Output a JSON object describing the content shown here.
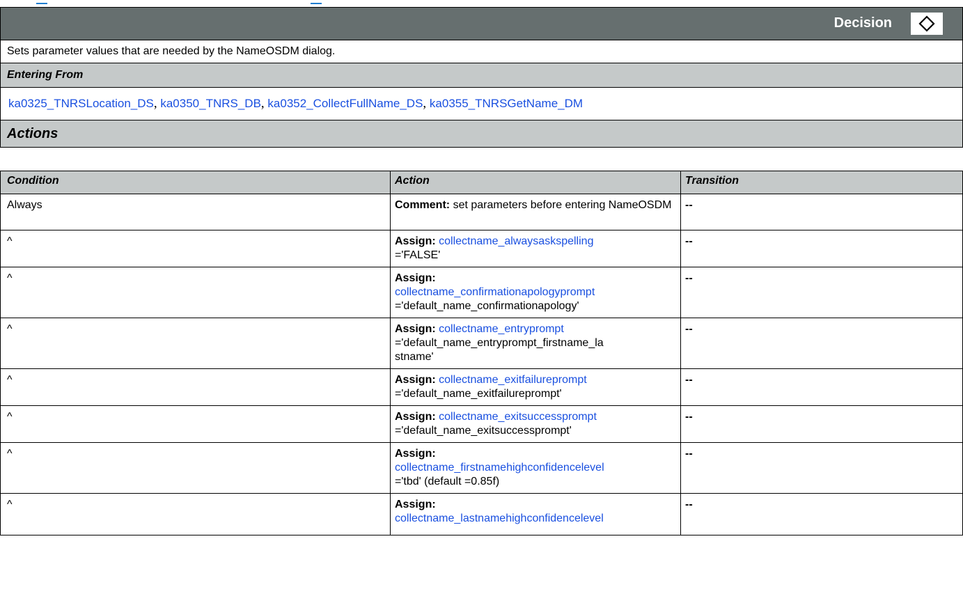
{
  "header": {
    "type_label": "Decision",
    "icon": "diamond-icon"
  },
  "description": "Sets parameter values that are needed by the NameOSDM dialog.",
  "entering_from": {
    "heading": "Entering From",
    "links": [
      "ka0325_TNRSLocation_DS",
      "ka0350_TNRS_DB",
      "ka0352_CollectFullName_DS",
      "ka0355_TNRSGetName_DM"
    ],
    "separator": ","
  },
  "actions": {
    "heading": "Actions",
    "columns": [
      "Condition",
      "Action",
      "Transition"
    ],
    "rows": [
      {
        "condition": "Always",
        "action_kind": "Comment:",
        "action_text": "set parameters before entering NameOSDM",
        "transition": "--"
      },
      {
        "condition": "^",
        "action_kind": "Assign:",
        "action_link": "collectname_alwaysaskspelling",
        "action_value": "='FALSE'",
        "transition": "--"
      },
      {
        "condition": "^",
        "action_kind": "Assign:",
        "action_link": "collectname_confirmationapologyprompt",
        "action_value": "='default_name_confirmationapology'",
        "transition": "--"
      },
      {
        "condition": "^",
        "action_kind": "Assign:",
        "action_link": "collectname_entryprompt",
        "action_value": "='default_name_entryprompt_firstname_la",
        "action_value2": "stname'",
        "transition": "--"
      },
      {
        "condition": "^",
        "action_kind": "Assign:",
        "action_link": "collectname_exitfailureprompt",
        "action_value": "='default_name_exitfailureprompt'",
        "transition": "--"
      },
      {
        "condition": "^",
        "action_kind": "Assign:",
        "action_link": "collectname_exitsuccessprompt",
        "action_value": "='default_name_exitsuccessprompt'",
        "transition": "--"
      },
      {
        "condition": "^",
        "action_kind": "Assign:",
        "action_link": "collectname_firstnamehighconfidencelevel",
        "action_value": "='tbd' (default =0.85f)",
        "transition": "--"
      },
      {
        "condition": "^",
        "action_kind": "Assign:",
        "action_link": "collectname_lastnamehighconfidencelevel",
        "action_value": "",
        "transition": "--"
      }
    ]
  },
  "colors": {
    "header_bg": "#666f6f",
    "section_bg": "#c5c9c9",
    "link": "#1a50e0"
  }
}
